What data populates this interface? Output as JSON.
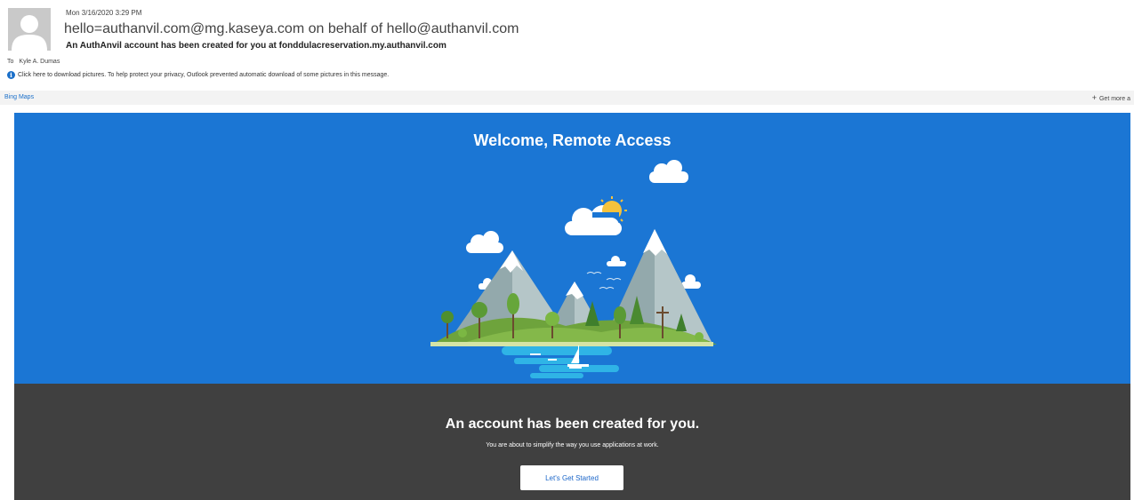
{
  "email": {
    "date": "Mon 3/16/2020 3:29 PM",
    "from": "hello=authanvil.com@mg.kaseya.com on behalf of hello@authanvil.com",
    "subject": "An AuthAnvil account has been created for you at fonddulacreservation.my.authanvil.com",
    "to_label": "To",
    "to_name": "Kyle A. Dumas",
    "privacy_notice": "Click here to download pictures. To help protect your privacy, Outlook prevented automatic download of some pictures in this message."
  },
  "addins": {
    "bing_maps": "Bing Maps",
    "get_more": "Get more a"
  },
  "hero": {
    "title": "Welcome, Remote Access",
    "illustration": "mountain-island-icon"
  },
  "footer": {
    "heading": "An account has been created for you.",
    "subtext": "You are about to simplify the way you use applications at work.",
    "button_label": "Let's Get Started"
  },
  "colors": {
    "hero_bg": "#1b76d4",
    "footer_bg": "#404040",
    "button_text": "#1b66c9",
    "link": "#1a6fc9"
  }
}
